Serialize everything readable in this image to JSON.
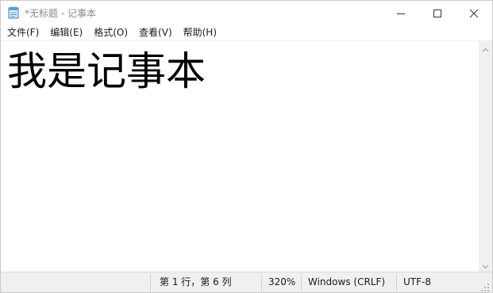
{
  "window": {
    "title": "*无标题 - 记事本"
  },
  "titlebar": {
    "icons": {
      "app": "notepad-icon",
      "minimize": "minimize-icon",
      "maximize": "maximize-icon",
      "close": "close-icon"
    }
  },
  "menu": {
    "items": [
      {
        "label": "文件(F)"
      },
      {
        "label": "编辑(E)"
      },
      {
        "label": "格式(O)"
      },
      {
        "label": "查看(V)"
      },
      {
        "label": "帮助(H)"
      }
    ]
  },
  "editor": {
    "content": "我是记事本"
  },
  "statusbar": {
    "position": "第 1 行，第 6 列",
    "zoom": "320%",
    "line_ending": "Windows (CRLF)",
    "encoding": "UTF-8"
  },
  "colors": {
    "title_text": "#8a8a8a",
    "statusbar_bg": "#f0f0f0",
    "scrollbar_bg": "#f0f0f0"
  }
}
